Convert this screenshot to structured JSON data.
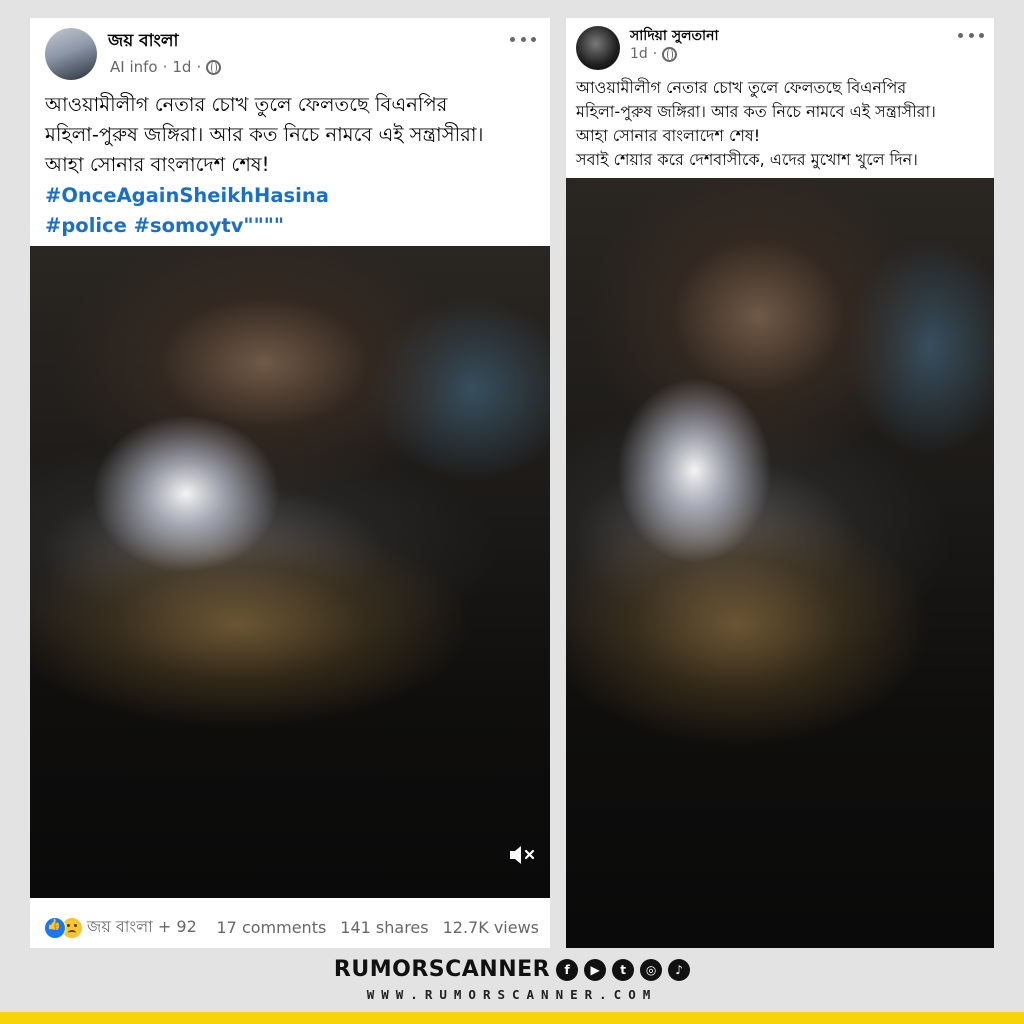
{
  "post_left": {
    "author": "জয় বাংলা",
    "meta_info": "AI info",
    "meta_dot": "·",
    "time": "1d",
    "dot2": "·",
    "text_lines": [
      "আওয়ামীলীগ নেতার চোখ তুলে ফেলতছে বিএনপির",
      "মহিলা-পুরুষ জঙ্গিরা। আর কত নিচে নামবে এই সন্ত্রাসীরা।",
      "আহা সোনার বাংলাদেশ শেষ!"
    ],
    "hashtag_line1": "#OnceAgainSheikhHasina",
    "hashtag_line2": "#police #somoytv\"\"\"\"",
    "reactions_label": "জয় বাংলা + 92",
    "comments": "17 comments",
    "shares": "141 shares",
    "views": "12.7K views"
  },
  "post_right": {
    "author": "সাদিয়া সুলতানা",
    "time": "1d",
    "dot": "·",
    "text_lines": [
      "আওয়ামীলীগ নেতার চোখ তুলে ফেলতছে বিএনপির",
      "মহিলা-পুরুষ জঙ্গিরা। আর কত নিচে নামবে এই সন্ত্রাসীরা।",
      "আহা সোনার বাংলাদেশ শেষ!",
      "সবাই শেয়ার করে দেশবাসীকে, এদের মুখোশ খুলে দিন।"
    ]
  },
  "branding": {
    "title": "RUMORSCANNER",
    "url": "WWW.RUMORSCANNER.COM",
    "social_icons": [
      "facebook-icon",
      "youtube-icon",
      "twitter-icon",
      "instagram-icon",
      "tiktok-icon"
    ],
    "social_glyphs": [
      "f",
      "▶",
      "t",
      "◎",
      "♪"
    ],
    "accent_color": "#f5d50a",
    "hashtag_color": "#1a6fc9"
  }
}
